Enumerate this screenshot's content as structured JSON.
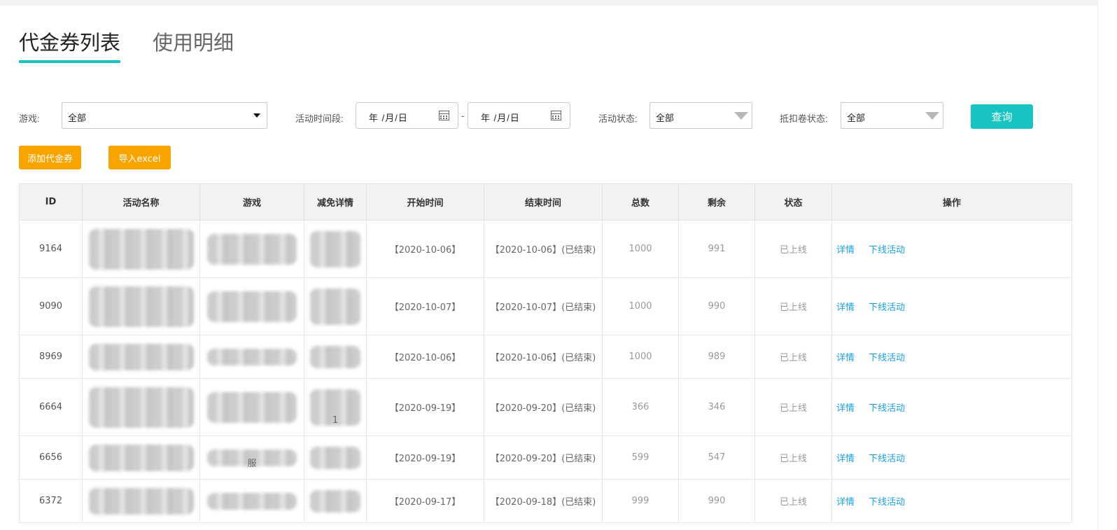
{
  "tabs": [
    {
      "label": "代金券列表",
      "active": true
    },
    {
      "label": "使用明细",
      "active": false
    }
  ],
  "filters": {
    "game_label": "游戏:",
    "game_value": "全部",
    "period_label": "活动时间段:",
    "date_start": "年 /月/日",
    "date_sep": "-",
    "date_end": "年 /月/日",
    "activity_status_label": "活动状态:",
    "activity_status_value": "全部",
    "voucher_status_label": "抵扣卷状态:",
    "voucher_status_value": "全部",
    "query_button": "查询"
  },
  "actions": {
    "add_voucher": "添加代金券",
    "import_excel": "导入excel"
  },
  "table": {
    "headers": [
      "ID",
      "活动名称",
      "游戏",
      "减免详情",
      "开始时间",
      "结束时间",
      "总数",
      "剩余",
      "状态",
      "操作"
    ],
    "rows": [
      {
        "id": "9164",
        "game_text": "",
        "detail_text": "",
        "start": "【2020-10-06】",
        "end": "【2020-10-06】(已结束)",
        "total": "1000",
        "remaining": "991",
        "status": "已上线",
        "op1": "详情",
        "op2": "下线活动"
      },
      {
        "id": "9090",
        "game_text": "",
        "detail_text": "",
        "start": "【2020-10-07】",
        "end": "【2020-10-07】(已结束)",
        "total": "1000",
        "remaining": "990",
        "status": "已上线",
        "op1": "详情",
        "op2": "下线活动"
      },
      {
        "id": "8969",
        "game_text": "",
        "detail_text": "",
        "start": "【2020-10-06】",
        "end": "【2020-10-06】(已结束)",
        "total": "1000",
        "remaining": "989",
        "status": "已上线",
        "op1": "详情",
        "op2": "下线活动"
      },
      {
        "id": "6664",
        "game_text": "",
        "detail_text": "1",
        "start": "【2020-09-19】",
        "end": "【2020-09-20】(已结束)",
        "total": "366",
        "remaining": "346",
        "status": "已上线",
        "op1": "详情",
        "op2": "下线活动"
      },
      {
        "id": "6656",
        "game_text": "服",
        "detail_text": "",
        "start": "【2020-09-19】",
        "end": "【2020-09-20】(已结束)",
        "total": "599",
        "remaining": "547",
        "status": "已上线",
        "op1": "详情",
        "op2": "下线活动"
      },
      {
        "id": "6372",
        "game_text": "",
        "detail_text": "",
        "start": "【2020-09-17】",
        "end": "【2020-09-18】(已结束)",
        "total": "999",
        "remaining": "990",
        "status": "已上线",
        "op1": "详情",
        "op2": "下线活动"
      }
    ]
  },
  "colors": {
    "accent": "#17c4c2",
    "orange": "#f7a400",
    "link": "#1aa0e0"
  },
  "icons": [
    "calendar-icon",
    "dropdown-caret-icon"
  ]
}
